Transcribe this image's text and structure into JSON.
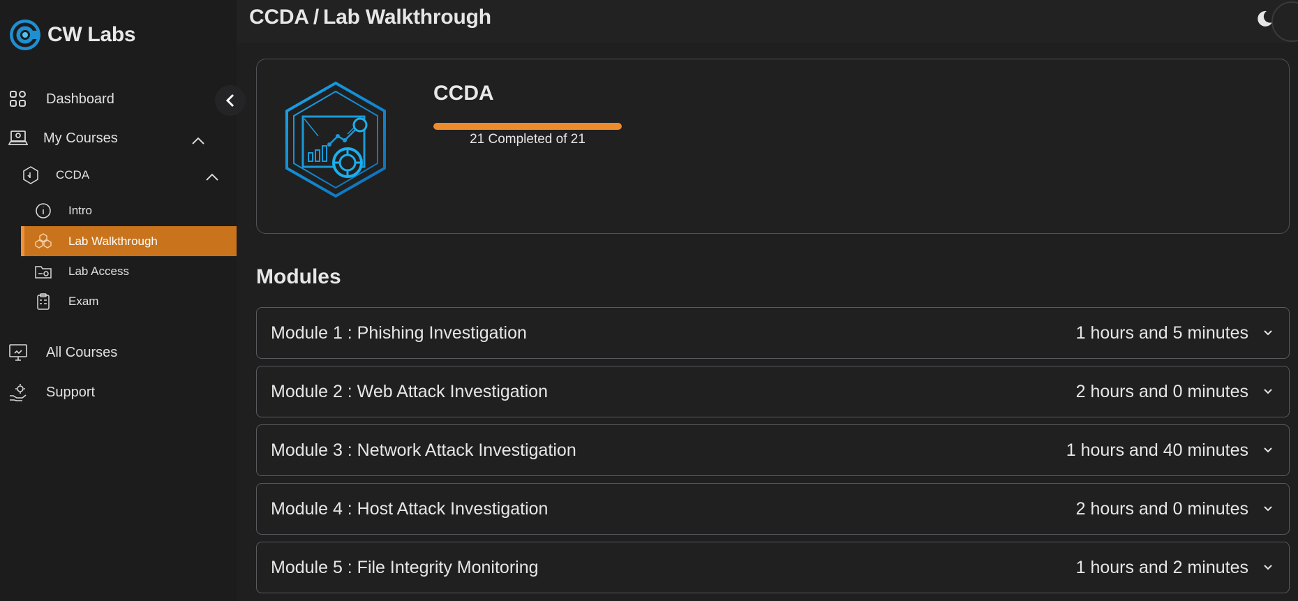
{
  "brand": {
    "name": "CW Labs",
    "accent": "#2a9fd6"
  },
  "header": {
    "breadcrumb": [
      "CCDA",
      "Lab Walkthrough"
    ],
    "separator": "/"
  },
  "sidebar": {
    "dashboard": "Dashboard",
    "my_courses": "My Courses",
    "course": "CCDA",
    "children": [
      {
        "label": "Intro",
        "icon": "info-icon"
      },
      {
        "label": "Lab Walkthrough",
        "icon": "cubes-icon",
        "active": true
      },
      {
        "label": "Lab Access",
        "icon": "folder-icon"
      },
      {
        "label": "Exam",
        "icon": "clipboard-icon"
      }
    ],
    "all_courses": "All Courses",
    "support": "Support",
    "active_color": "#c9741c"
  },
  "course_card": {
    "name": "CCDA",
    "progress_text": "21 Completed of 21",
    "completed": 21,
    "total": 21,
    "progress_color": "#ee8b2d"
  },
  "modules": {
    "heading": "Modules",
    "items": [
      {
        "title": "Module 1 : Phishing Investigation",
        "duration": "1 hours and 5 minutes"
      },
      {
        "title": "Module 2 : Web Attack Investigation",
        "duration": "2 hours and 0 minutes"
      },
      {
        "title": "Module 3 : Network Attack Investigation",
        "duration": "1 hours and 40 minutes"
      },
      {
        "title": "Module 4 : Host Attack Investigation",
        "duration": "2 hours and 0 minutes"
      },
      {
        "title": "Module 5 : File Integrity Monitoring",
        "duration": "1 hours and 2 minutes"
      }
    ]
  }
}
